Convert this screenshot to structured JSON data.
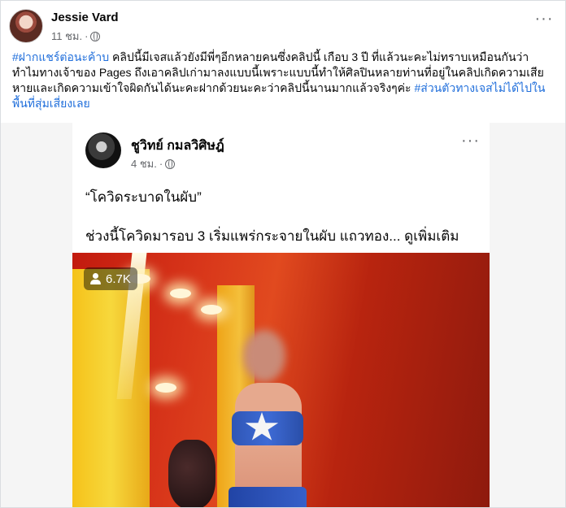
{
  "post": {
    "author": "Jessie Vard",
    "time": "11 ชม.",
    "text_segments": [
      {
        "text": "#ฝากแชร์ต่อนะค้าบ",
        "hashtag": true
      },
      {
        "text": " คลิปนี้มีเจสแล้วยังมีพี่ๆอีกหลายคนซึ่งคลิปนี้ เกือบ 3 ปี ที่แล้วนะคะไม่ทราบเหมือนกันว่าทำไมทางเจ้าของ Pages ถึงเอาคลิปเก่ามาลงแบบนี้เพราะแบบนี้ทำให้ศิลปินหลายท่านที่อยู่ในคลิปเกิดความเสียหายและเกิดความเข้าใจผิดกันได้นะคะฝากด้วยนะคะว่าคลิปนี้นานมากแล้วจริงๆค่ะ ",
        "hashtag": false
      },
      {
        "text": "#ส่วนตัวทางเจสไม่ได้ไปในพื้นที่สุ่มเสี่ยงเลย",
        "hashtag": true
      }
    ]
  },
  "shared": {
    "author": "ชูวิทย์ กมลวิศิษฎ์",
    "time": "4 ชม.",
    "quote": "“โควิดระบาดในผับ”",
    "body": "ช่วงนี้โควิดมารอบ 3 เริ่มแพร่กระจายในผับ แถวทอง...",
    "see_more": "ดูเพิ่มเติม",
    "views": "6.7K"
  },
  "icons": {
    "more": "more-options-icon",
    "privacy": "globe-icon",
    "views": "person-icon"
  },
  "colors": {
    "hashtag": "#216fdb",
    "text": "#050505",
    "meta": "#65676b"
  }
}
